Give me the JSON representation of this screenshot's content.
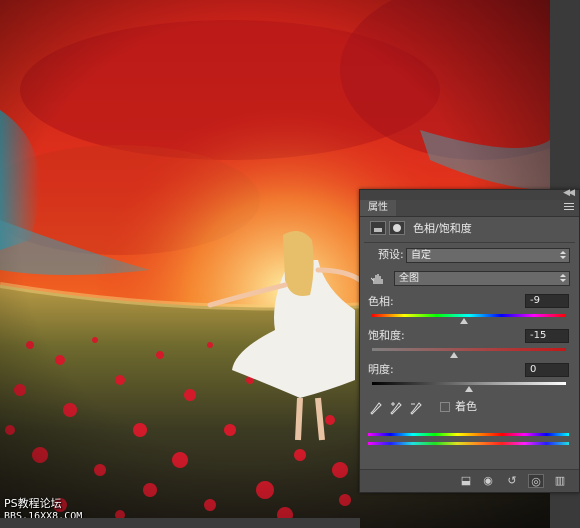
{
  "panel": {
    "tab_label": "属性",
    "adjustment_title": "色相/饱和度",
    "preset_label": "预设:",
    "preset_value": "自定",
    "channel_value": "全图",
    "hue_label": "色相:",
    "hue_value": "-9",
    "saturation_label": "饱和度:",
    "saturation_value": "-15",
    "lightness_label": "明度:",
    "lightness_value": "0",
    "colorize_label": "着色",
    "footer_icons": [
      "clip-to-layer-icon",
      "view-previous-icon",
      "reset-icon",
      "visibility-icon",
      "delete-icon"
    ]
  },
  "sliders": {
    "hue": {
      "value": -9,
      "min": -180,
      "max": 180
    },
    "saturation": {
      "value": -15,
      "min": -100,
      "max": 100
    },
    "lightness": {
      "value": 0,
      "min": -100,
      "max": 100
    }
  },
  "watermark": {
    "line1": "PS教程论坛",
    "line2": "BBS.16XX8.COM"
  },
  "colors": {
    "panel_bg": "#535353",
    "field_bg": "#2e2e2e",
    "dropdown_bg": "#6a6a6a",
    "sky_red": "#e0301c",
    "poppy_red": "#d21a2a"
  }
}
